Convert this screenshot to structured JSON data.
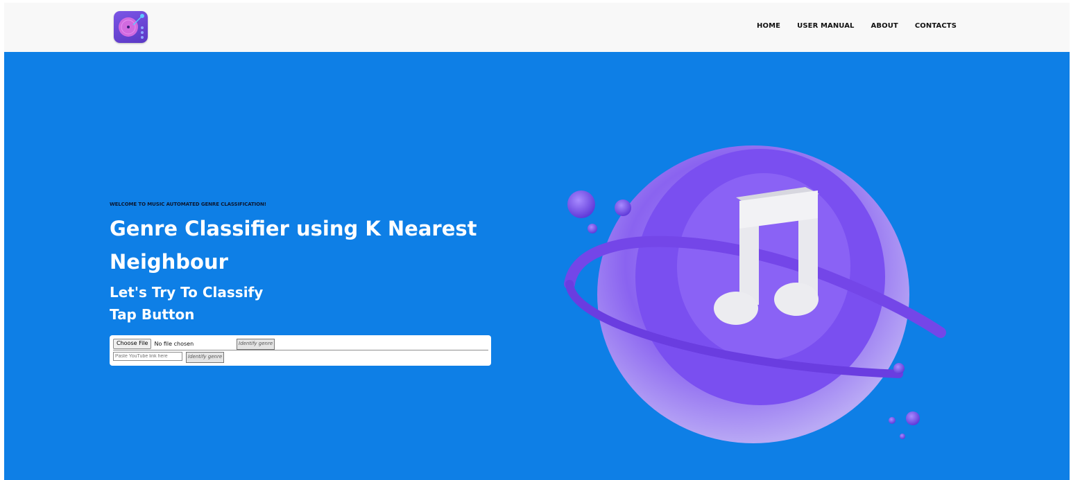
{
  "nav": {
    "items": [
      {
        "label": "HOME"
      },
      {
        "label": "USER MANUAL"
      },
      {
        "label": "ABOUT"
      },
      {
        "label": "CONTACTS"
      }
    ]
  },
  "hero": {
    "eyebrow": "WELCOME TO MUSIC AUTOMATED GENRE CLASSIFICATION!",
    "title": "Genre Classifier using K Nearest Neighbour",
    "subtitle_line1": "Let's Try To Classify",
    "subtitle_line2": "Tap Button"
  },
  "form": {
    "choose_file_label": "Choose File",
    "no_file_text": "No file chosen",
    "identify_label": "Identify genre",
    "youtube_placeholder": "Paste YouTube link here",
    "identify_label_2": "Identify genre"
  },
  "colors": {
    "hero_bg": "#0e7fe6",
    "header_bg": "#f8f8f8",
    "accent_purple": "#7b55e6"
  },
  "icons": {
    "logo": "turntable-logo-icon",
    "illustration": "music-note-planet-illustration"
  }
}
